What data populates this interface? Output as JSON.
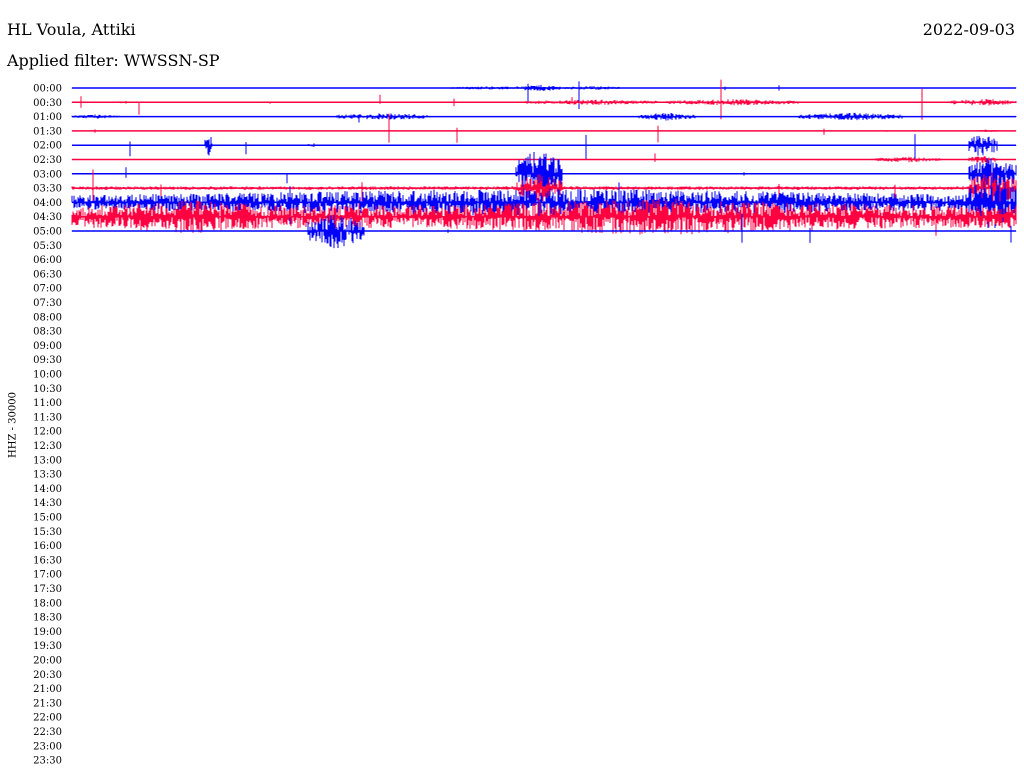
{
  "header": {
    "station": "HL Voula, Attiki",
    "date": "2022-09-03",
    "filter": "Applied filter: WWSSN-SP"
  },
  "chart_data": {
    "type": "helicorder",
    "channel_label": "HHZ - 30000",
    "colors": [
      "#0000ff",
      "#ff0040"
    ],
    "rows": [
      {
        "time": "00:00",
        "amplitude": 0.05,
        "bursts": [
          [
            0.4,
            0.48,
            0.25
          ],
          [
            0.47,
            0.52,
            0.45
          ],
          [
            0.52,
            0.58,
            0.3
          ]
        ]
      },
      {
        "time": "00:30",
        "amplitude": 0.05,
        "bursts": [
          [
            0.05,
            0.06,
            0.25
          ],
          [
            0.48,
            0.62,
            0.4
          ],
          [
            0.63,
            0.77,
            0.45
          ],
          [
            0.93,
            1.0,
            0.5
          ]
        ]
      },
      {
        "time": "01:00",
        "amplitude": 0.06,
        "bursts": [
          [
            0.0,
            0.05,
            0.3
          ],
          [
            0.28,
            0.38,
            0.5
          ],
          [
            0.6,
            0.66,
            0.55
          ],
          [
            0.77,
            0.88,
            0.55
          ]
        ]
      },
      {
        "time": "01:30",
        "amplitude": 0.03,
        "bursts": [
          [
            0.96,
            0.98,
            0.2
          ]
        ]
      },
      {
        "time": "02:00",
        "amplitude": 0.03,
        "bursts": [
          [
            0.14,
            0.15,
            1.5
          ],
          [
            0.25,
            0.26,
            0.3
          ],
          [
            0.95,
            0.98,
            1.8
          ]
        ]
      },
      {
        "time": "02:30",
        "amplitude": 0.03,
        "bursts": [
          [
            0.85,
            0.92,
            0.4
          ],
          [
            0.95,
            0.98,
            0.6
          ]
        ]
      },
      {
        "time": "03:00",
        "amplitude": 0.03,
        "bursts": [
          [
            0.47,
            0.52,
            3.5
          ],
          [
            0.95,
            1.0,
            2.5
          ]
        ]
      },
      {
        "time": "03:30",
        "amplitude": 0.25,
        "bursts": [
          [
            0.47,
            0.52,
            2.0
          ],
          [
            0.95,
            1.0,
            2.5
          ]
        ]
      },
      {
        "time": "04:00",
        "amplitude": 0.8,
        "bursts": [
          [
            0.0,
            1.0,
            2.0
          ],
          [
            0.95,
            1.0,
            4.0
          ]
        ]
      },
      {
        "time": "04:30",
        "amplitude": 1.6,
        "bursts": [
          [
            0.0,
            0.25,
            2.4
          ],
          [
            0.25,
            0.3,
            0.3
          ],
          [
            0.3,
            0.95,
            2.6
          ]
        ]
      },
      {
        "time": "05:00",
        "amplitude": 0.05,
        "bursts": [
          [
            0.25,
            0.31,
            2.5
          ]
        ]
      }
    ]
  }
}
